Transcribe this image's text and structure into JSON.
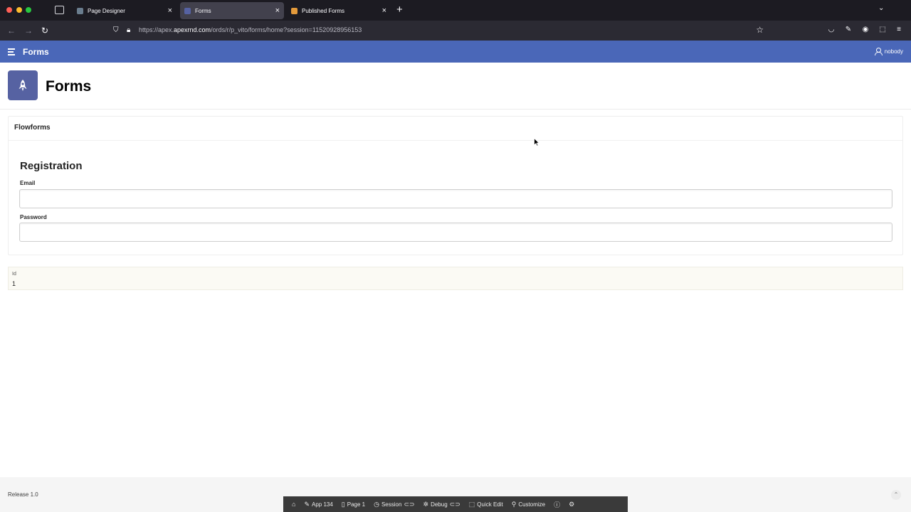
{
  "browser": {
    "tabs": [
      {
        "title": "Page Designer",
        "favicon_color": "#6a7d8e",
        "active": false
      },
      {
        "title": "Forms",
        "favicon_color": "#5662a2",
        "active": true
      },
      {
        "title": "Published Forms",
        "favicon_color": "#e39a3b",
        "active": false
      }
    ],
    "new_tab_glyph": "+",
    "url": {
      "prefix": "https://apex.",
      "domain": "apexrnd.com",
      "path": "/ords/r/p_vito/forms/home?session=11520928956153"
    }
  },
  "header": {
    "app_title": "Forms",
    "user": "nobody"
  },
  "hero": {
    "title": "Forms",
    "icon": "rocket-icon"
  },
  "region": {
    "title": "Flowforms",
    "form_title": "Registration",
    "fields": [
      {
        "label": "Email",
        "value": ""
      },
      {
        "label": "Password",
        "value": ""
      }
    ]
  },
  "id_item": {
    "label": "Id",
    "value": "1"
  },
  "footer": {
    "release": "Release 1.0"
  },
  "dev_toolbar": {
    "items": [
      {
        "label": "",
        "icon": "home-icon"
      },
      {
        "label": "App 134",
        "icon": "edit-icon"
      },
      {
        "label": "Page 1",
        "icon": "page-icon"
      },
      {
        "label": "Session",
        "icon": "session-icon"
      },
      {
        "label": "Debug",
        "icon": "debug-icon"
      },
      {
        "label": "Quick Edit",
        "icon": "quick-edit-icon"
      },
      {
        "label": "Customize",
        "icon": "customize-icon"
      },
      {
        "label": "",
        "icon": "info-icon"
      },
      {
        "label": "",
        "icon": "settings-icon"
      }
    ]
  },
  "colors": {
    "header_bg": "#4a67b8",
    "hero_icon_bg": "#5662a2"
  }
}
